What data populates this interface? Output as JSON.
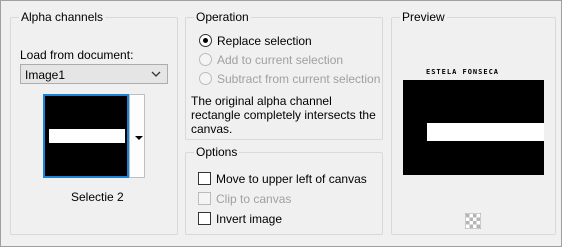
{
  "alpha_channels": {
    "title": "Alpha channels",
    "load_from_label": "Load from document:",
    "document_select": {
      "value": "Image1"
    },
    "channel_name": "Selectie 2"
  },
  "operation": {
    "title": "Operation",
    "options": [
      {
        "label": "Replace selection",
        "selected": true,
        "enabled": true
      },
      {
        "label": "Add to current selection",
        "selected": false,
        "enabled": false
      },
      {
        "label": "Subtract from current selection",
        "selected": false,
        "enabled": false
      }
    ],
    "description": [
      "The original alpha channel",
      "rectangle completely intersects the",
      "canvas."
    ]
  },
  "options": {
    "title": "Options",
    "items": [
      {
        "label": "Move to upper left of canvas",
        "checked": false,
        "enabled": true
      },
      {
        "label": "Clip to canvas",
        "checked": false,
        "enabled": false
      },
      {
        "label": "Invert image",
        "checked": false,
        "enabled": true
      }
    ]
  },
  "preview": {
    "title": "Preview",
    "watermark": "ESTELA FONSECA"
  },
  "colors": {
    "accent": "#1e82d2",
    "background": "#f0f0f0",
    "disabled_text": "#a0a0a0"
  },
  "icons": {
    "dropdown": "chevron-down-icon",
    "thumbnail_dropdown": "triangle-down-icon",
    "transparency": "checkerboard-icon"
  }
}
